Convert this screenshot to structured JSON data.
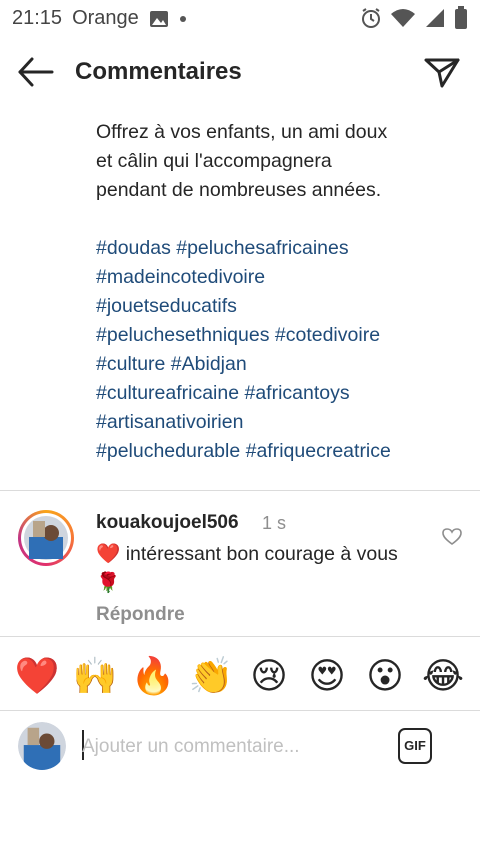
{
  "statusbar": {
    "time": "21:15",
    "carrier": "Orange"
  },
  "header": {
    "title": "Commentaires"
  },
  "post": {
    "caption_lines": [
      "Offrez à vos enfants, un ami doux",
      "et câlin qui l'accompagnera",
      "pendant de nombreuses années."
    ],
    "hashtag_lines": [
      "#doudas #peluchesafricaines",
      "#madeincotedivoire",
      "#jouetseducatifs",
      "#peluchesethniques #cotedivoire",
      "#culture #Abidjan",
      "#cultureafricaine #africantoys",
      "#artisanativoirien",
      "#peluchedurable #afriquecreatrice"
    ]
  },
  "comment": {
    "username": "kouakoujoel506",
    "time": "1 s",
    "text_line1": "❤️ intéressant bon courage à vous",
    "text_line2": "🌹",
    "reply_label": "Répondre"
  },
  "emoji_bar": [
    "❤️",
    "🙌",
    "🔥",
    "👏",
    "😢",
    "😍",
    "😮",
    "😂"
  ],
  "composer": {
    "placeholder": "Ajouter un commentaire...",
    "gif_label": "GIF"
  },
  "colors": {
    "hashtag": "#1f4b79",
    "muted": "#8e8e8e",
    "text": "#262626"
  }
}
